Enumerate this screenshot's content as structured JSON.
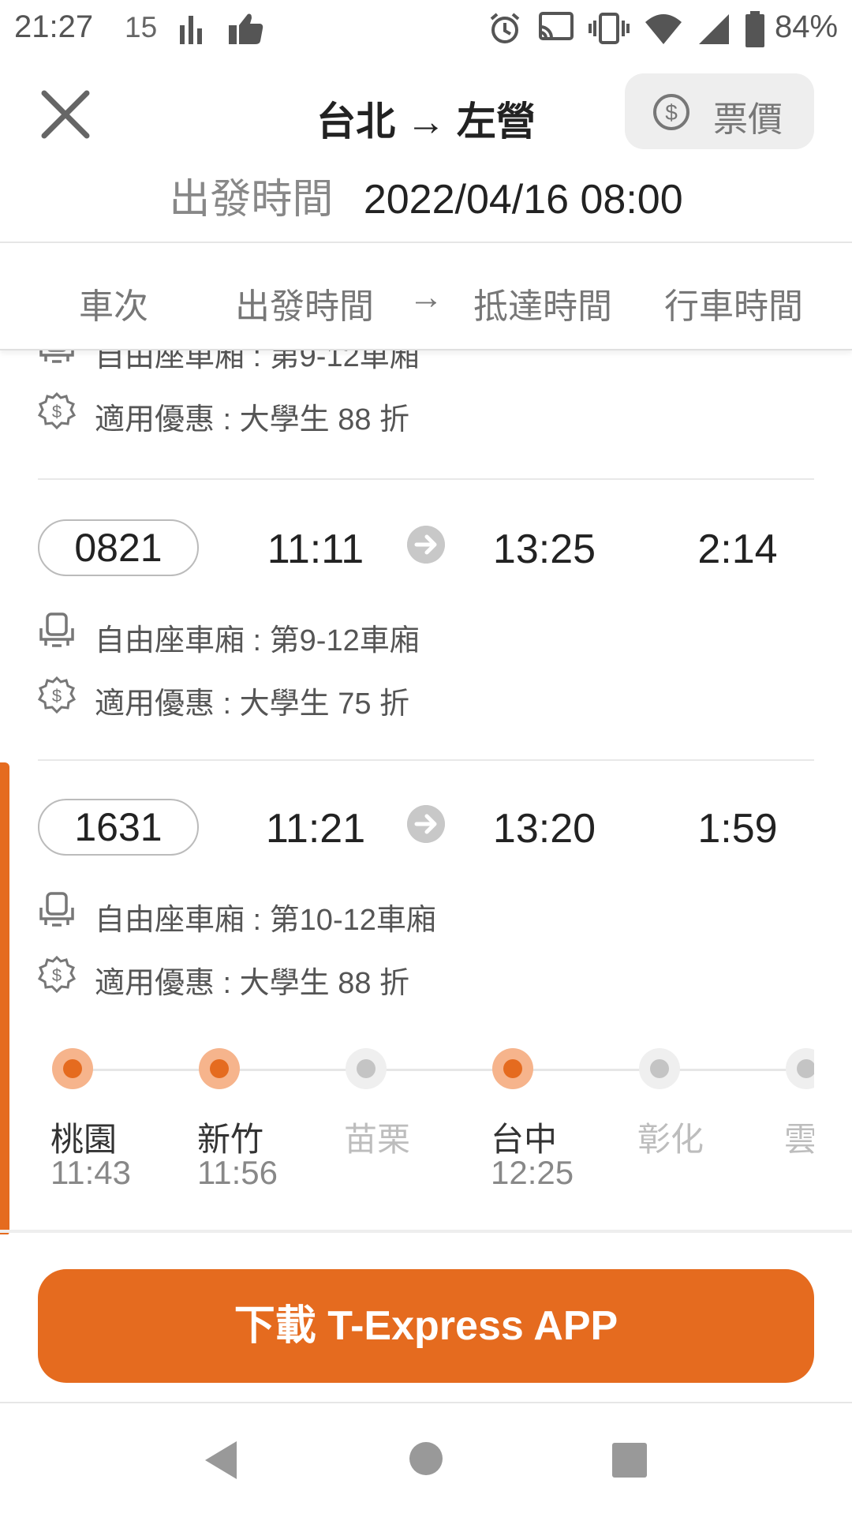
{
  "status_bar": {
    "time": "21:27",
    "notification_count": "15",
    "battery": "84%"
  },
  "header": {
    "route": "台北 → 左營",
    "fare_button": "票價",
    "departure_label": "出發時間",
    "departure_value": "2022/04/16 08:00"
  },
  "columns": {
    "train": "車次",
    "depart": "出發時間",
    "arrow": "→",
    "arrive": "抵達時間",
    "duration": "行車時間"
  },
  "partial_item": {
    "seat": "自由座車廂 : 第9-12車廂",
    "discount": "適用優惠 : 大學生 88 折"
  },
  "trains": [
    {
      "number": "0821",
      "depart": "11:11",
      "arrive": "13:25",
      "duration": "2:14",
      "seat": "自由座車廂 : 第9-12車廂",
      "discount": "適用優惠 : 大學生 75 折"
    },
    {
      "number": "1631",
      "depart": "11:21",
      "arrive": "13:20",
      "duration": "1:59",
      "seat": "自由座車廂 : 第10-12車廂",
      "discount": "適用優惠 : 大學生 88 折"
    }
  ],
  "stops": [
    {
      "name": "桃園",
      "time": "11:43",
      "stops": true
    },
    {
      "name": "新竹",
      "time": "11:56",
      "stops": true
    },
    {
      "name": "苗栗",
      "time": "",
      "stops": false
    },
    {
      "name": "台中",
      "time": "12:25",
      "stops": true
    },
    {
      "name": "彰化",
      "time": "",
      "stops": false
    },
    {
      "name": "雲",
      "time": "",
      "stops": false
    }
  ],
  "download_button": "下載 T-Express APP",
  "colors": {
    "accent": "#e56b1f"
  }
}
